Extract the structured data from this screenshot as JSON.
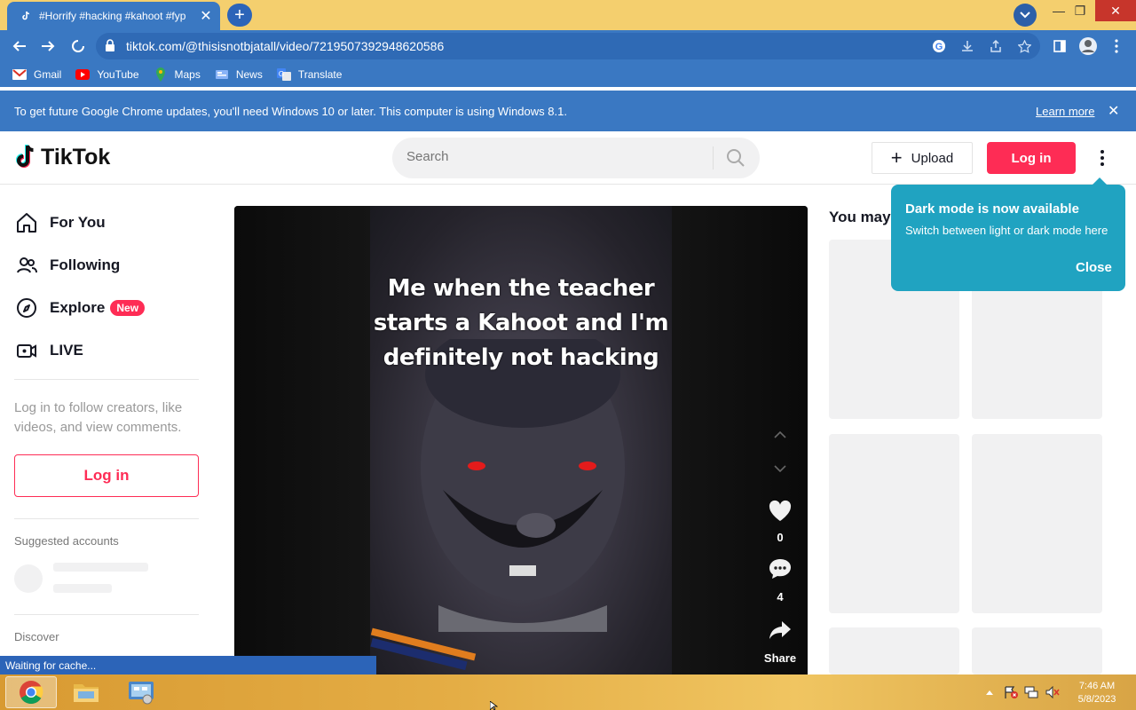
{
  "browser": {
    "tab_title": "#Horrify #hacking #kahoot #fyp",
    "url": "tiktok.com/@thisisnotbjatall/video/7219507392948620586",
    "bookmarks": [
      {
        "label": "Gmail",
        "icon": "gmail-icon"
      },
      {
        "label": "YouTube",
        "icon": "youtube-icon"
      },
      {
        "label": "Maps",
        "icon": "maps-icon"
      },
      {
        "label": "News",
        "icon": "news-icon"
      },
      {
        "label": "Translate",
        "icon": "translate-icon"
      }
    ],
    "infobar": {
      "message": "To get future Google Chrome updates, you'll need Windows 10 or later. This computer is using Windows 8.1.",
      "link": "Learn more"
    },
    "status": "Waiting for cache..."
  },
  "tiktok": {
    "logo": "TikTok",
    "search_placeholder": "Search",
    "upload": "Upload",
    "login": "Log in",
    "nav": [
      {
        "label": "For You",
        "icon": "home-icon"
      },
      {
        "label": "Following",
        "icon": "following-icon"
      },
      {
        "label": "Explore",
        "icon": "compass-icon",
        "badge": "New"
      },
      {
        "label": "LIVE",
        "icon": "live-icon"
      }
    ],
    "sidebar_prompt": "Log in to follow creators, like videos, and view comments.",
    "sidebar_login": "Log in",
    "suggested": "Suggested accounts",
    "discover": "Discover",
    "video": {
      "caption": "Me when the teacher starts a Kahoot and I'm definitely not hacking",
      "likes": "0",
      "comments": "4",
      "share": "Share"
    },
    "you_may_like": "You may",
    "tooltip": {
      "title": "Dark mode is now available",
      "body": "Switch between light or dark mode here",
      "close": "Close"
    }
  },
  "taskbar": {
    "time": "7:46 AM",
    "date": "5/8/2023"
  },
  "colors": {
    "accent": "#fe2c55",
    "chrome_blue": "#3a78c2",
    "tooltip": "#20a3c1"
  }
}
